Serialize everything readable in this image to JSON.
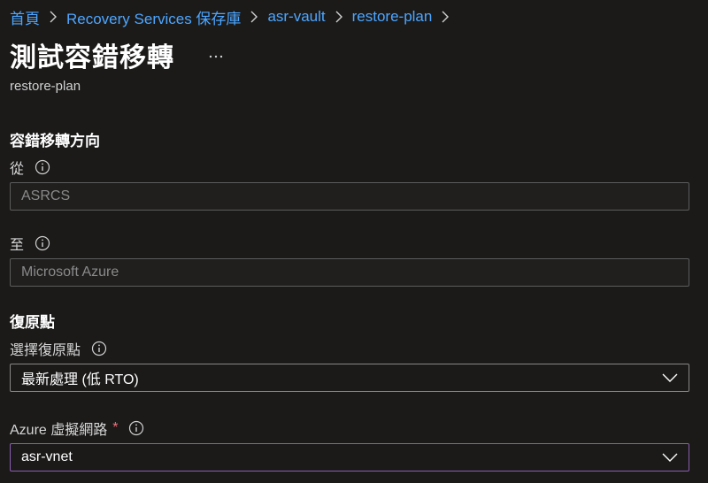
{
  "breadcrumb": {
    "items": [
      "首頁",
      "Recovery Services 保存庫",
      "asr-vault",
      "restore-plan"
    ]
  },
  "header": {
    "title": "測試容錯移轉",
    "more_label": "...",
    "subtitle": "restore-plan"
  },
  "failover_direction": {
    "heading": "容錯移轉方向",
    "from": {
      "label": "從",
      "value": "ASRCS"
    },
    "to": {
      "label": "至",
      "value": "Microsoft Azure"
    }
  },
  "recovery_point": {
    "heading": "復原點",
    "select_label": "選擇復原點",
    "selected_value": "最新處理 (低 RTO)"
  },
  "network": {
    "label": "Azure 虛擬網路",
    "required_mark": "*",
    "selected_value": "asr-vnet"
  },
  "icons": {
    "breadcrumb_separator": "chevron-right-icon",
    "info": "info-icon",
    "dropdown": "chevron-down-icon",
    "more": "ellipsis-icon"
  },
  "colors": {
    "background": "#1b1a19",
    "link": "#4da6ff",
    "required": "#f1707b",
    "focus_border": "#8b5db0"
  }
}
